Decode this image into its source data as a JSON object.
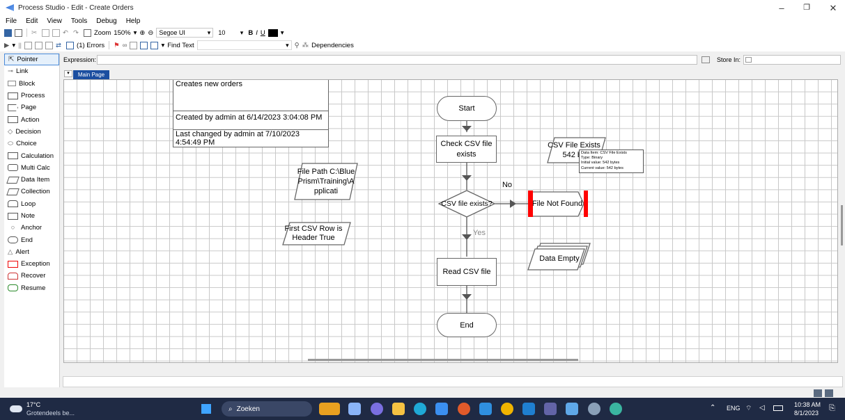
{
  "window": {
    "title": "Process Studio  - Edit - Create Orders"
  },
  "menu": [
    "File",
    "Edit",
    "View",
    "Tools",
    "Debug",
    "Help"
  ],
  "toolbar1": {
    "zoom_label": "Zoom",
    "zoom_value": "150%",
    "font_name": "Segoe UI",
    "font_size": "10",
    "bold": "B",
    "italic": "I",
    "underline": "U"
  },
  "toolbar2": {
    "errors_label": "(1) Errors",
    "find_label": "Find Text",
    "find_value": "",
    "dependencies_label": "Dependencies"
  },
  "toolbox": {
    "items": [
      "Pointer",
      "Link",
      "Block",
      "Process",
      "Page",
      "Action",
      "Decision",
      "Choice",
      "Calculation",
      "Multi Calc",
      "Data Item",
      "Collection",
      "Loop",
      "Note",
      "Anchor",
      "End",
      "Alert",
      "Exception",
      "Recover",
      "Resume"
    ]
  },
  "expression": {
    "label": "Expression:",
    "value": "",
    "store_label": "Store In:"
  },
  "tabs": {
    "main_page": "Main Page"
  },
  "info_box": {
    "description": "Creates new orders",
    "created": "Created by admin at 6/14/2023 3:04:08 PM",
    "changed": "Last changed by admin at 7/10/2023 4:54:49 PM"
  },
  "flow": {
    "start": "Start",
    "check_csv": "Check CSV file exists",
    "decision": "CSV file exists?",
    "no_label": "No",
    "yes_label": "Yes",
    "not_found": "File Not Found",
    "read_csv": "Read CSV file",
    "end": "End"
  },
  "data_items": {
    "csv_exists": "CSV File Exists 542 by",
    "file_path": "File Path C:\\BluePrism\\Training\\Applicati",
    "first_row": "First CSV Row is Header True",
    "data_empty": "Data Empty"
  },
  "tooltip": {
    "line1": "Data Item: CSV File Exists",
    "line2": "Type: Binary",
    "line3": "Initial value: 542 bytes",
    "line4": "Current value: 542 bytes"
  },
  "taskbar": {
    "temperature": "17°C",
    "weather": "Grotendeels be...",
    "search": "Zoeken",
    "lang": "ENG",
    "time": "10:38 AM",
    "date": "8/1/2023"
  },
  "colors": {
    "exception_red": "#ff0000",
    "taskbar": "#1f2a44",
    "accent": "#2b6cd4"
  }
}
